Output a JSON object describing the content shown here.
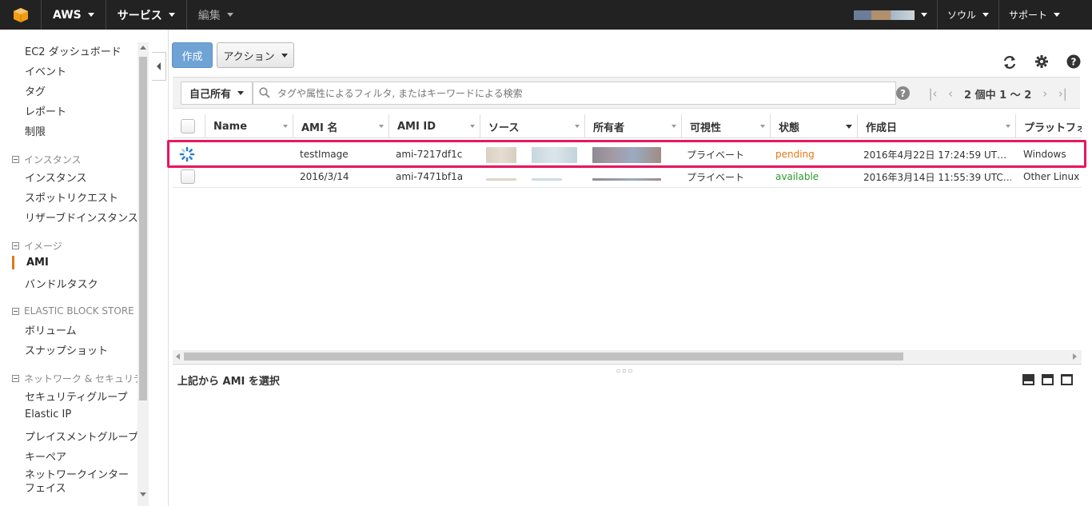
{
  "topnav": {
    "brand": "AWS",
    "services": "サービス",
    "edit": "編集",
    "region": "ソウル",
    "support": "サポート",
    "colors": {
      "bar": "#222222",
      "logo": "#f39c12"
    }
  },
  "sidebar": {
    "items_top": [
      "EC2 ダッシュボード",
      "イベント",
      "タグ",
      "レポート",
      "制限"
    ],
    "group_instances": "インスタンス",
    "instances_items": [
      "インスタンス",
      "スポットリクエスト",
      "リザーブドインスタンス"
    ],
    "group_images": "イメージ",
    "images_items": [
      "AMI",
      "バンドルタスク"
    ],
    "group_ebs": "ELASTIC BLOCK STORE",
    "ebs_items": [
      "ボリューム",
      "スナップショット"
    ],
    "group_network": "ネットワーク & セキュリティ",
    "network_items": [
      "セキュリティグループ",
      "Elastic IP",
      "プレイスメントグループ",
      "キーペア",
      "ネットワークインターフェイス"
    ],
    "active_item": "AMI",
    "active_color": "#e47911"
  },
  "toolbar": {
    "create_label": "作成",
    "action_label": "アクション",
    "icons": [
      "refresh-icon",
      "gear-icon",
      "help-icon"
    ]
  },
  "filter": {
    "dropdown_label": "自己所有",
    "placeholder": "タグや属性によるフィルタ, またはキーワードによる検索",
    "pager_text": "2 個中 1 〜 2"
  },
  "table": {
    "columns": [
      "Name",
      "AMI 名",
      "AMI ID",
      "ソース",
      "所有者",
      "可視性",
      "状態",
      "作成日",
      "プラットフォー"
    ],
    "rows": [
      {
        "name": "",
        "ami_name": "testImage",
        "ami_id": "ami-7217df1c",
        "visibility": "プライベート",
        "state": "pending",
        "created": "2016年4月22日 17:24:59 UT…",
        "platform": "Windows"
      },
      {
        "name": "",
        "ami_name": "2016/3/14",
        "ami_id": "ami-7471bf1a",
        "visibility": "プライベート",
        "state": "available",
        "created": "2016年3月14日 11:55:39 UTC…",
        "platform": "Other Linux"
      }
    ],
    "state_colors": {
      "pending": "#e47911",
      "available": "#2d9a2d"
    },
    "highlight_color": "#e8175d"
  },
  "detail": {
    "title": "上記から AMI を選択"
  }
}
